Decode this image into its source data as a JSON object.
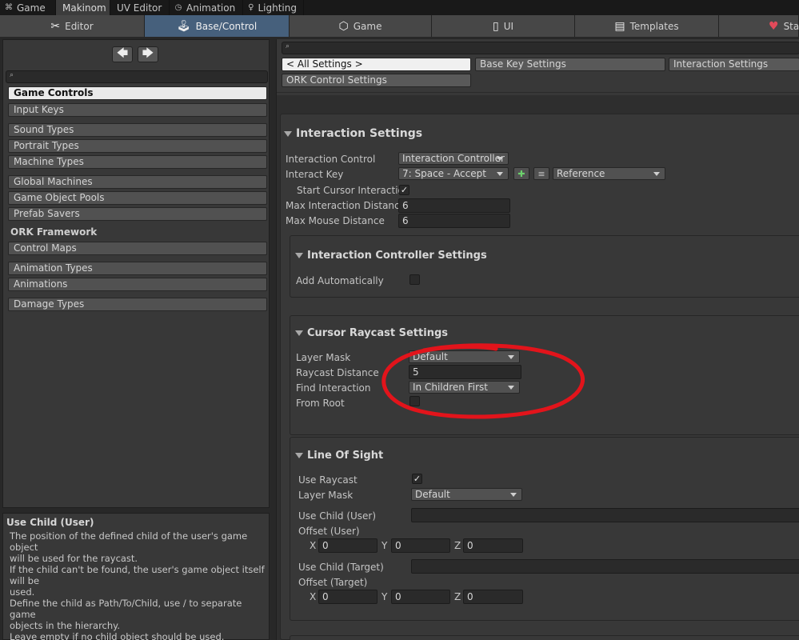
{
  "window_tabs": [
    {
      "label": "Game",
      "icon": "gamepad-icon",
      "glyph": "⌘",
      "active": false
    },
    {
      "label": "Makinom",
      "icon": "",
      "glyph": "",
      "active": true
    },
    {
      "label": "UV Editor",
      "icon": "",
      "glyph": "",
      "active": false
    },
    {
      "label": "Animation",
      "icon": "animation-icon",
      "glyph": "◷",
      "active": false
    },
    {
      "label": "Lighting",
      "icon": "bulb-icon",
      "glyph": "♀",
      "active": false
    }
  ],
  "toolbar": [
    {
      "label": "Editor",
      "icon": "tools-icon",
      "glyph": "✂",
      "active": false
    },
    {
      "label": "Base/Control",
      "icon": "gamepad-icon",
      "glyph": "🎮",
      "active": true
    },
    {
      "label": "Game",
      "icon": "dice-icon",
      "glyph": "⬡",
      "active": false
    },
    {
      "label": "UI",
      "icon": "ui-icon",
      "glyph": "▯",
      "active": false
    },
    {
      "label": "Templates",
      "icon": "document-icon",
      "glyph": "▤",
      "active": false
    },
    {
      "label": "Sta",
      "icon": "heart-icon",
      "glyph": "♥",
      "active": false
    }
  ],
  "left_panel": {
    "nav_back": "🡄",
    "nav_forward": "🡆",
    "search_placeholder": "",
    "search_icon": "⌕",
    "items": [
      {
        "label": "Game Controls",
        "selected": true
      },
      {
        "label": "Input Keys"
      },
      {
        "label": "Sound Types"
      },
      {
        "label": "Portrait Types"
      },
      {
        "label": "Machine Types"
      },
      {
        "label": "Global Machines"
      },
      {
        "label": "Game Object Pools"
      },
      {
        "label": "Prefab Savers"
      },
      {
        "label": "Control Maps"
      },
      {
        "label": "Animation Types"
      },
      {
        "label": "Animations"
      },
      {
        "label": "Damage Types"
      }
    ],
    "section_header": "ORK Framework"
  },
  "help": {
    "title": "Use Child (User)",
    "lines": [
      "The position of the defined child of the user's game object",
      "will be used for the raycast.",
      "If the child can't be found, the user's game object itself will be",
      "used.",
      "Define the child as Path/To/Child, use / to separate game",
      "objects in the hierarchy.",
      "Leave empty if no child object should be used."
    ]
  },
  "right_panel": {
    "search_icon": "⌕",
    "buttons": [
      "< All Settings >",
      "Base Key Settings",
      "Interaction Settings",
      "ORK Control Settings"
    ],
    "interaction_settings": {
      "title": "Interaction Settings",
      "interaction_control_label": "Interaction Control",
      "interaction_control_value": "Interaction Controller",
      "interact_key_label": "Interact Key",
      "interact_key_value": "7: Space - Accept",
      "interact_key_mode": "Reference",
      "add_glyph": "✚",
      "list_glyph": "≡",
      "start_cursor_label": "Start Cursor Interaction",
      "start_cursor_checked": true,
      "max_interaction_label": "Max Interaction Distance",
      "max_interaction_value": "6",
      "max_mouse_label": "Max Mouse Distance",
      "max_mouse_value": "6"
    },
    "controller_settings": {
      "title": "Interaction Controller Settings",
      "add_auto_label": "Add Automatically",
      "add_auto_checked": false
    },
    "cursor_raycast": {
      "title": "Cursor Raycast Settings",
      "layer_mask_label": "Layer Mask",
      "layer_mask_value": "Default",
      "raycast_distance_label": "Raycast Distance",
      "raycast_distance_value": "5",
      "find_interaction_label": "Find Interaction",
      "find_interaction_value": "In Children First",
      "from_root_label": "From Root",
      "from_root_checked": false
    },
    "line_of_sight": {
      "title": "Line Of Sight",
      "use_raycast_label": "Use Raycast",
      "use_raycast_checked": true,
      "layer_mask_label": "Layer Mask",
      "layer_mask_value": "Default",
      "use_child_user_label": "Use Child (User)",
      "use_child_user_value": "",
      "offset_user_label": "Offset (User)",
      "offset_user": {
        "x": "0",
        "y": "0",
        "z": "0"
      },
      "use_child_target_label": "Use Child (Target)",
      "use_child_target_value": "",
      "offset_target_label": "Offset (Target)",
      "offset_target": {
        "x": "0",
        "y": "0",
        "z": "0"
      },
      "axis_x": "X",
      "axis_y": "Y",
      "axis_z": "Z"
    }
  },
  "check_glyph": "✓",
  "colors": {
    "annotation_red": "#e2141b",
    "active_tab_blue": "#46607c"
  }
}
